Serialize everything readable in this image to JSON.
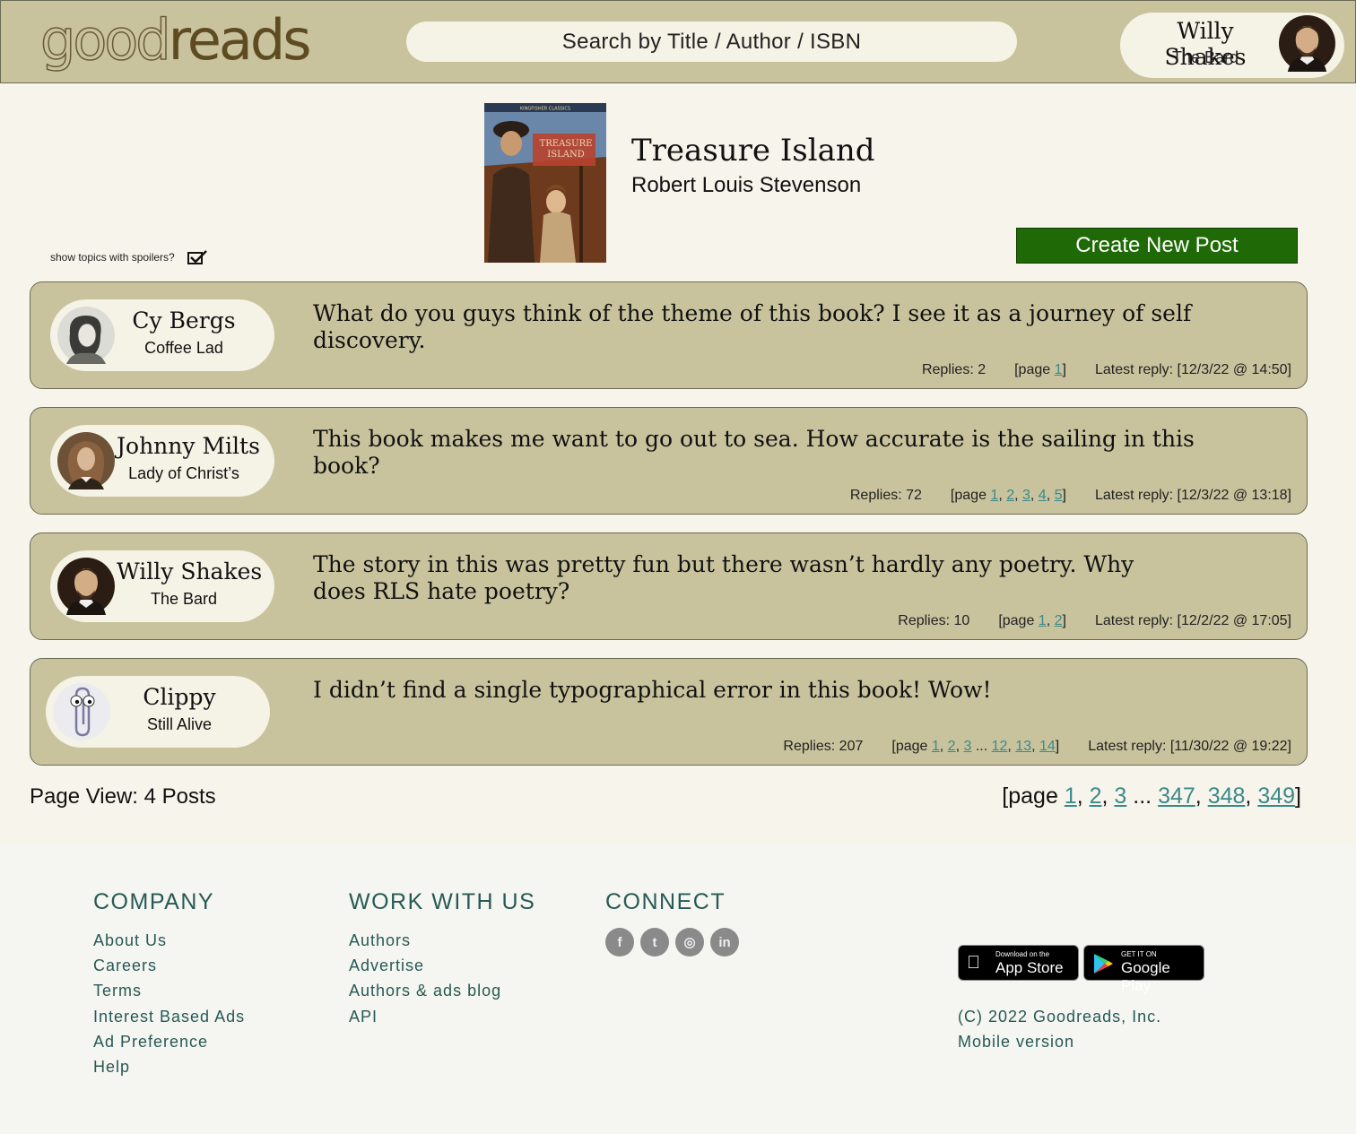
{
  "header": {
    "logo_part1": "good",
    "logo_part2": "reads",
    "search_placeholder": "Search by Title / Author / ISBN",
    "user": {
      "name": "Willy Shakes",
      "title": "The Bard"
    }
  },
  "book": {
    "title": "Treasure Island",
    "author": "Robert Louis Stevenson",
    "cover_text": "TREASURE ISLAND",
    "cover_series": "KINGFISHER CLASSICS"
  },
  "controls": {
    "spoiler_label": "show topics with spoilers?",
    "create_post": "Create New Post"
  },
  "posts": [
    {
      "user": "Cy Bergs",
      "user_title": "Coffee Lad",
      "text": "What do you guys think of the theme of this book? I see it as a journey of self discovery.",
      "replies": "Replies: 2",
      "pages": [
        "1"
      ],
      "latest": "Latest reply: [12/3/22 @ 14:50]"
    },
    {
      "user": "Johnny Milts",
      "user_title": "Lady of Christ’s",
      "text": "This book makes me want to go out to sea. How accurate is the sailing in this book?",
      "replies": "Replies: 72",
      "pages": [
        "1",
        "2",
        "3",
        "4",
        "5"
      ],
      "latest": "Latest reply: [12/3/22 @ 13:18]"
    },
    {
      "user": "Willy Shakes",
      "user_title": "The Bard",
      "text": "The story in this was pretty fun but there wasn’t hardly any poetry. Why does RLS hate poetry?",
      "replies": "Replies: 10",
      "pages": [
        "1",
        "2"
      ],
      "latest": "Latest reply: [12/2/22 @ 17:05]"
    },
    {
      "user": "Clippy",
      "user_title": "Still Alive",
      "text": "I didn’t find a single typographical error in this book! Wow!",
      "replies": "Replies: 207",
      "pages": [
        "1",
        "2",
        "3",
        "...",
        "12",
        "13",
        "14"
      ],
      "latest": "Latest reply: [11/30/22 @ 19:22]"
    }
  ],
  "page_view": "Page View: 4 Posts",
  "pager": {
    "prefix": "[page",
    "pages": [
      "1",
      "2",
      "3",
      "...",
      "347",
      "348",
      "349"
    ],
    "suffix": "]"
  },
  "footer": {
    "company": {
      "heading": "COMPANY",
      "links": [
        "About Us",
        "Careers",
        "Terms",
        "Interest Based Ads",
        "Ad Preference",
        "Help"
      ]
    },
    "work": {
      "heading": "WORK WITH US",
      "links": [
        "Authors",
        "Advertise",
        "Authors & ads blog",
        "API"
      ]
    },
    "connect": {
      "heading": "CONNECT",
      "icons": [
        "facebook-icon",
        "twitter-icon",
        "instagram-icon",
        "linkedin-icon"
      ]
    },
    "app_store": {
      "small": "Download on the",
      "big": "App Store"
    },
    "google_play": {
      "small": "GET IT ON",
      "big": "Google Play"
    },
    "copyright": "(C) 2022 Goodreads, Inc.",
    "mobile": "Mobile version"
  },
  "colors": {
    "header_bg": "#c8c39d",
    "page_bg": "#f7f4ec",
    "create_btn": "#1f6a06",
    "footer_link": "#275a55",
    "link": "#3b8a8a"
  }
}
